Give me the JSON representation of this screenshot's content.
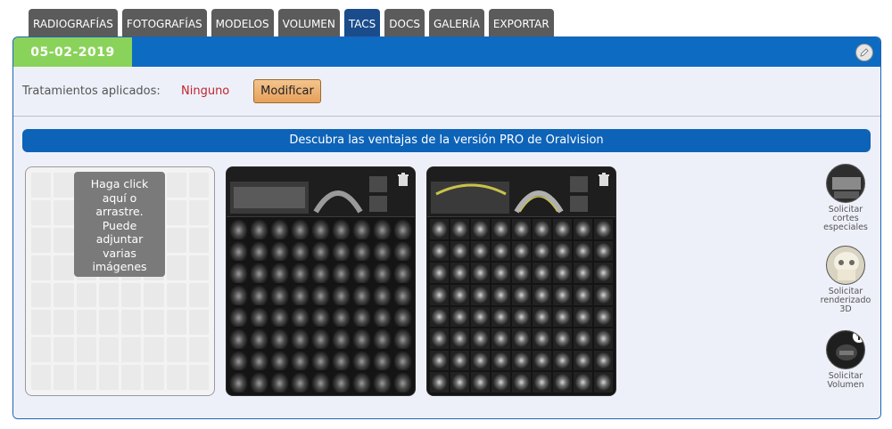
{
  "tabs": [
    {
      "label": "RADIOGRAFÍAS",
      "active": false
    },
    {
      "label": "FOTOGRAFÍAS",
      "active": false
    },
    {
      "label": "MODELOS",
      "active": false
    },
    {
      "label": "VOLUMEN",
      "active": false
    },
    {
      "label": "TACS",
      "active": true
    },
    {
      "label": "DOCS",
      "active": false
    },
    {
      "label": "GALERÍA",
      "active": false
    },
    {
      "label": "EXPORTAR",
      "active": false
    }
  ],
  "header": {
    "date": "05-02-2019",
    "edit_icon": "pencil-icon"
  },
  "treatments": {
    "label": "Tratamientos aplicados:",
    "value": "Ninguno",
    "modify_button": "Modificar"
  },
  "promo": {
    "text": "Descubra las ventajas de la versión PRO de Oralvision"
  },
  "dropzone": {
    "message_lines": [
      "Haga click",
      "aquí o",
      "arrastre.",
      "Puede",
      "adjuntar",
      "varias",
      "imágenes"
    ]
  },
  "scans": [
    {
      "name": "tac-scan-1",
      "trash_icon": "trash-icon"
    },
    {
      "name": "tac-scan-2",
      "trash_icon": "trash-icon"
    }
  ],
  "side_tools": [
    {
      "label_lines": [
        "Solicitar",
        "cortes",
        "especiales"
      ]
    },
    {
      "label_lines": [
        "Solicitar",
        "renderizado",
        "3D"
      ]
    },
    {
      "label_lines": [
        "Solicitar",
        "Volumen"
      ]
    }
  ],
  "colors": {
    "tab_bg": "#5b5b5b",
    "tab_active_bg": "#1a4c8c",
    "header_blue": "#0d6bc2",
    "date_green": "#8ad35a",
    "treatment_value_red": "#c0242f",
    "modify_button_orange": "#e7a05a"
  }
}
